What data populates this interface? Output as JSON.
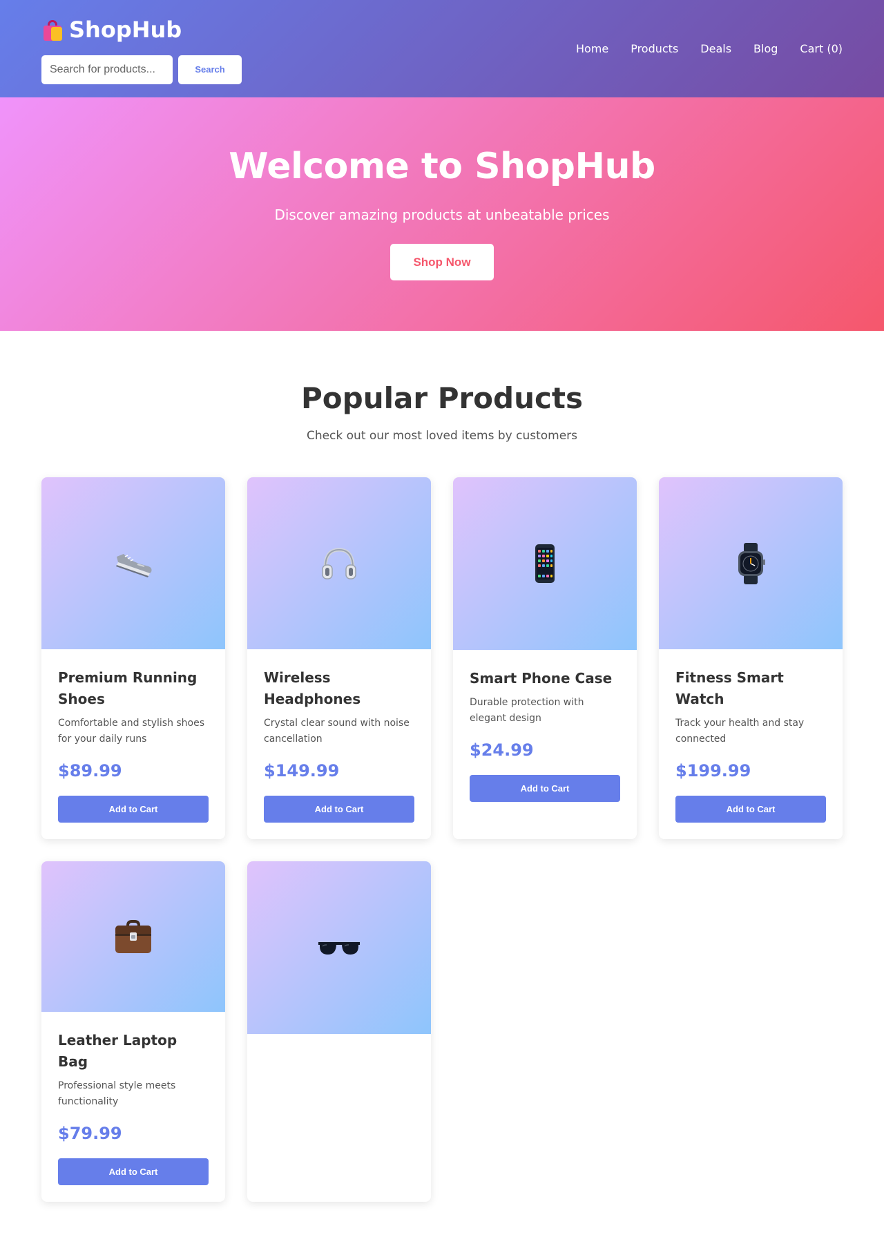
{
  "header": {
    "logo_text": "ShopHub",
    "logo_icon": "shopping-bags-icon",
    "search": {
      "placeholder": "Search for products...",
      "button_label": "Search"
    },
    "nav": [
      {
        "label": "Home"
      },
      {
        "label": "Products"
      },
      {
        "label": "Deals"
      },
      {
        "label": "Blog"
      },
      {
        "label": "Cart (0)"
      }
    ]
  },
  "hero": {
    "title": "Welcome to ShopHub",
    "subtitle": "Discover amazing products at unbeatable prices",
    "button_label": "Shop Now"
  },
  "products_section": {
    "title": "Popular Products",
    "subtitle": "Check out our most loved items by customers",
    "items": [
      {
        "icon": "running-shoe-icon",
        "name": "Premium Running Shoes",
        "description": "Comfortable and stylish shoes for your daily runs",
        "price": "$89.99",
        "button_label": "Add to Cart"
      },
      {
        "icon": "headphones-icon",
        "name": "Wireless Headphones",
        "description": "Crystal clear sound with noise cancellation",
        "price": "$149.99",
        "button_label": "Add to Cart"
      },
      {
        "icon": "mobile-phone-icon",
        "name": "Smart Phone Case",
        "description": "Durable protection with elegant design",
        "price": "$24.99",
        "button_label": "Add to Cart"
      },
      {
        "icon": "smart-watch-icon",
        "name": "Fitness Smart Watch",
        "description": "Track your health and stay connected",
        "price": "$199.99",
        "button_label": "Add to Cart"
      },
      {
        "icon": "briefcase-icon",
        "name": "Leather Laptop Bag",
        "description": "Professional style meets functionality",
        "price": "$79.99",
        "button_label": "Add to Cart"
      },
      {
        "icon": "sunglasses-icon"
      }
    ]
  },
  "colors": {
    "header_gradient": [
      "#667eea",
      "#764ba2"
    ],
    "hero_gradient": [
      "#f093fb",
      "#f5576c"
    ],
    "card_image_gradient": [
      "#e0c3fc",
      "#8ec5fc"
    ],
    "accent": "#667eea",
    "hero_button_text": "#f5576c"
  }
}
